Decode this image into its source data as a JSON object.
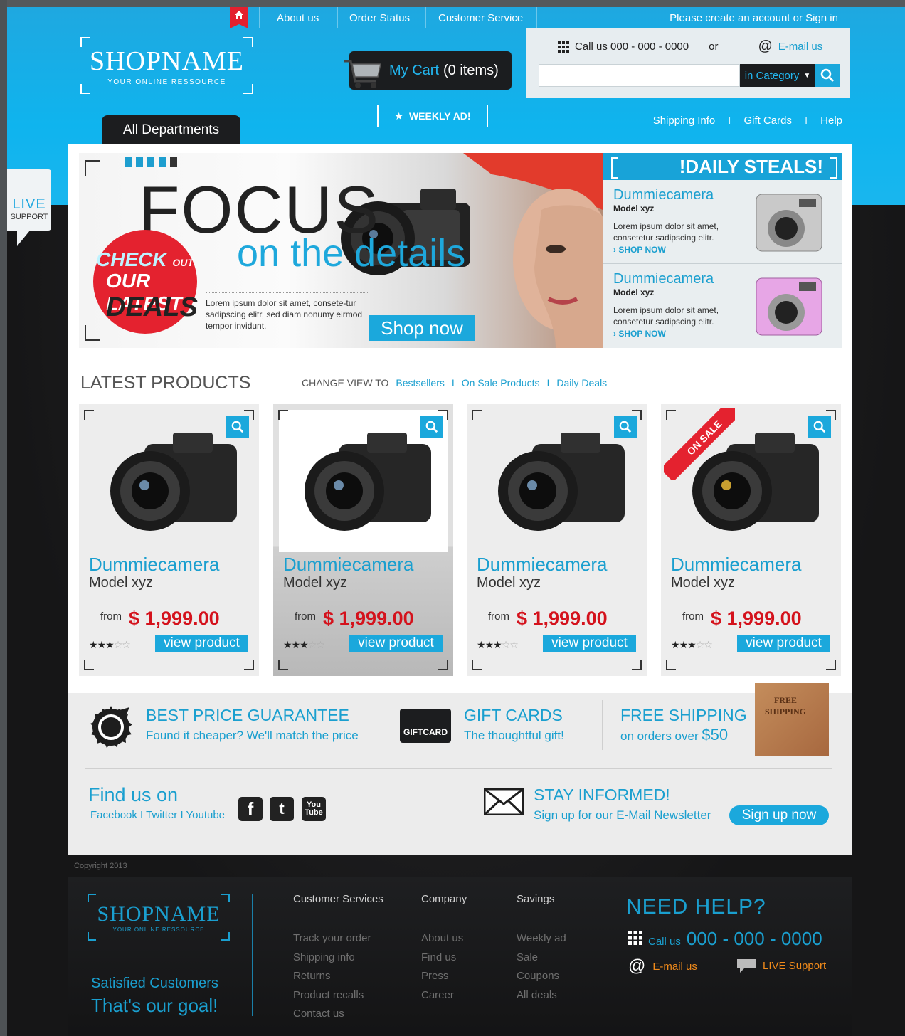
{
  "topnav": {
    "items": [
      "About us",
      "Order Status",
      "Customer Service"
    ],
    "signin": "Please create an account or Sign in"
  },
  "logo": {
    "name": "SHOPNAME",
    "sub": "YOUR ONLINE RESSOURCE"
  },
  "cart": {
    "label": "My Cart",
    "count": "(0 items)"
  },
  "weekly_ad": "WEEKLY AD!",
  "all_departments": "All Departments",
  "contact": {
    "call": "Call us 000 - 000 - 0000",
    "or": "or",
    "email": "E-mail us",
    "search_placeholder": "",
    "category": "in Category"
  },
  "sublinks": [
    "Shipping Info",
    "Gift Cards",
    "Help"
  ],
  "live_support": {
    "line1": "LIVE",
    "line2": "SUPPORT"
  },
  "hero": {
    "focus": "FOCUS",
    "details": "on the details",
    "check": "CHECK",
    "out": "OUT",
    "our_latest": "OUR LATEST",
    "deals": "DEALS",
    "text": "Lorem ipsum dolor sit amet, consete-tur sadipscing elitr, sed diam nonumy eirmod tempor invidunt.",
    "shop_now": "Shop now"
  },
  "daily_steals": {
    "title": "!DAILY STEALS!",
    "items": [
      {
        "title": "Dummiecamera",
        "model": "Model xyz",
        "desc": "Lorem ipsum dolor sit amet, consetetur sadipscing elitr.",
        "link": "› SHOP NOW",
        "color": "#c8c8c8"
      },
      {
        "title": "Dummiecamera",
        "model": "Model xyz",
        "desc": "Lorem ipsum dolor sit amet, consetetur sadipscing elitr.",
        "link": "› SHOP NOW",
        "color": "#e7a6e6"
      }
    ]
  },
  "latest": {
    "title": "LATEST PRODUCTS",
    "change_view": "CHANGE VIEW TO",
    "links": [
      "Bestsellers",
      "On Sale Products",
      "Daily Deals"
    ]
  },
  "products": [
    {
      "title": "Dummiecamera",
      "model": "Model xyz",
      "from": "from",
      "price": "$ 1,999.00",
      "button": "view product",
      "rating": 3
    },
    {
      "title": "Dummiecamera",
      "model": "Model xyz",
      "from": "from",
      "price": "$ 1,999.00",
      "button": "view product",
      "rating": 3
    },
    {
      "title": "Dummiecamera",
      "model": "Model xyz",
      "from": "from",
      "price": "$ 1,999.00",
      "button": "view product",
      "rating": 3
    },
    {
      "title": "Dummiecamera",
      "model": "Model xyz",
      "from": "from",
      "price": "$ 1,999.00",
      "button": "view product",
      "rating": 3,
      "badge": "ON SALE"
    }
  ],
  "features": {
    "price_title": "BEST PRICE GUARANTEE",
    "price_sub": "Found it cheaper? We'll match the price",
    "gift_badge": "GIFTCARD",
    "gift_title": "GIFT CARDS",
    "gift_sub": "The thoughtful gift!",
    "ship_title": "FREE SHIPPING",
    "ship_sub": "on orders over",
    "ship_amount": "$50",
    "box_text": "FREE SHIPPING"
  },
  "social": {
    "title": "Find us on",
    "links": "Facebook I Twitter I Youtube",
    "icons": [
      "facebook-icon",
      "twitter-icon",
      "youtube-icon"
    ]
  },
  "newsletter": {
    "title": "STAY INFORMED!",
    "sub": "Sign up for our E-Mail Newsletter",
    "button": "Sign up now"
  },
  "footer": {
    "copyright": "Copyright 2013",
    "logo_name": "SHOPNAME",
    "logo_sub": "YOUR ONLINE RESSOURCE",
    "slogan1": "Satisfied Customers",
    "slogan2": "That's our goal!",
    "columns": [
      {
        "heading": "Customer Services",
        "items": [
          "Track your order",
          "Shipping info",
          "Returns",
          "Product recalls",
          "Contact us"
        ]
      },
      {
        "heading": "Company",
        "items": [
          "About us",
          "Find us",
          "Press",
          "Career"
        ]
      },
      {
        "heading": "Savings",
        "items": [
          "Weekly ad",
          "Sale",
          "Coupons",
          "All deals"
        ]
      }
    ],
    "need_help": "NEED HELP?",
    "call_label": "Call us",
    "call_number": "000 - 000 - 0000",
    "email": "E-mail us",
    "live": "LIVE Support"
  },
  "colors": {
    "accent": "#1ba8dc",
    "price": "#d4121c",
    "sale": "#e4222f",
    "orange": "#f08a1a"
  }
}
